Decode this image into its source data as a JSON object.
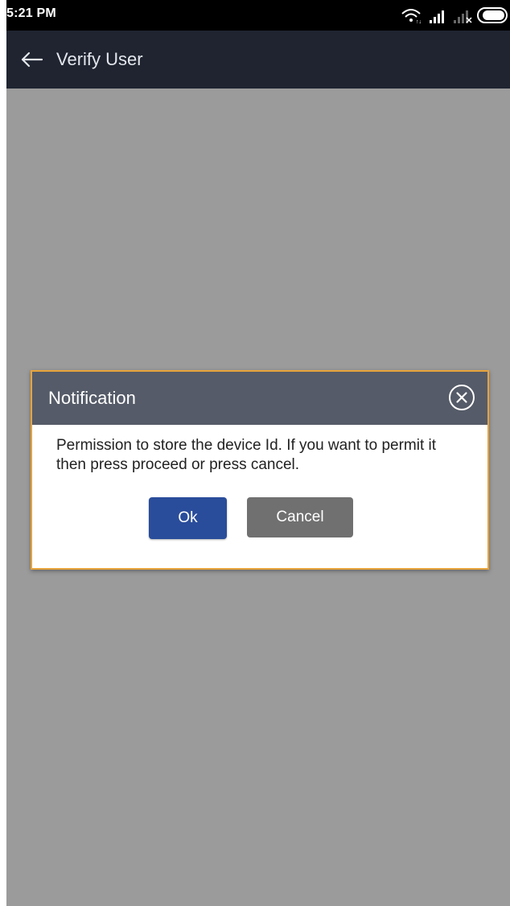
{
  "status_bar": {
    "time": "5:21 PM",
    "icons": [
      "wifi-icon",
      "signal-icon",
      "no-signal-icon",
      "battery-icon"
    ]
  },
  "app_bar": {
    "back_icon": "arrow-left-icon",
    "title": "Verify User"
  },
  "dialog": {
    "title": "Notification",
    "close_icon": "close-circle-icon",
    "message": "Permission to store the device Id. If you want to permit it then press proceed or press cancel.",
    "ok_label": "Ok",
    "cancel_label": "Cancel"
  },
  "colors": {
    "app_bar": "#1f2430",
    "overlay": "#9b9b9b",
    "dialog_header": "#555b68",
    "dialog_border": "#e8a33a",
    "ok_button": "#2a4d9b",
    "cancel_button": "#707070"
  }
}
